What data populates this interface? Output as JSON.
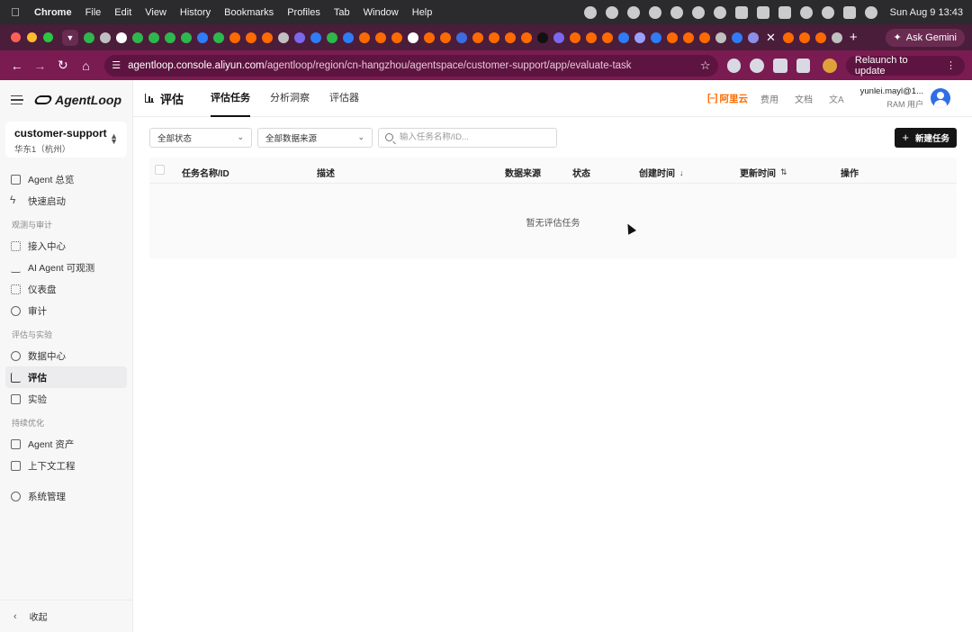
{
  "menubar": {
    "app": "Chrome",
    "items": [
      "File",
      "Edit",
      "View",
      "History",
      "Bookmarks",
      "Profiles",
      "Tab",
      "Window",
      "Help"
    ],
    "clock": "Sun Aug 9  13:43"
  },
  "tabstrip": {
    "gemini_label": "Ask Gemini",
    "tab_icon_colors": [
      "#2db84d",
      "#c0c0c0",
      "#ffffff",
      "#2db84d",
      "#2db84d",
      "#2db84d",
      "#2db84d",
      "#2e7cf6",
      "#2db84d",
      "#ff6a00",
      "#ff6a00",
      "#ff6a00",
      "#c0c0c0",
      "#7b68ee",
      "#2e7cf6",
      "#2db84d",
      "#2e7cf6",
      "#ff6a00",
      "#ff6a00",
      "#ff6a00",
      "#ffffff",
      "#ff6a00",
      "#ff6a00",
      "#3b6de0",
      "#ff6a00",
      "#ff6a00",
      "#ff6a00",
      "#ff6a00",
      "#111111",
      "#7b68ee",
      "#ff6a00",
      "#ff6a00",
      "#ff6a00",
      "#2e7cf6",
      "#9aa0ff",
      "#2e7cf6",
      "#ff6a00",
      "#ff6a00",
      "#ff6a00",
      "#c0c0c0",
      "#2e7cf6",
      "#8e8ee8"
    ],
    "tab_icon_colors_after": [
      "#ff6a00",
      "#ff6a00",
      "#ff6a00",
      "#c0c0c0"
    ]
  },
  "addressbar": {
    "url_host": "agentloop.console.aliyun.com",
    "url_path": "/agentloop/region/cn-hangzhou/agentspace/customer-support/app/evaluate-task",
    "relaunch": "Relaunch to update"
  },
  "sidebar": {
    "logo": "AgentLoop",
    "space_name": "customer-support",
    "space_region": "华东1（杭州）",
    "top_items": [
      {
        "label": "Agent 总览",
        "icon": "robot-icon"
      },
      {
        "label": "快速启动",
        "icon": "bolt-icon"
      }
    ],
    "groups": [
      {
        "title": "观测与审计",
        "items": [
          {
            "label": "接入中心",
            "icon": "grid-icon"
          },
          {
            "label": "AI Agent 可观测",
            "icon": "pulse-icon"
          },
          {
            "label": "仪表盘",
            "icon": "dashboard-icon"
          },
          {
            "label": "审计",
            "icon": "shield-icon"
          }
        ]
      },
      {
        "title": "评估与实验",
        "items": [
          {
            "label": "数据中心",
            "icon": "database-icon"
          },
          {
            "label": "评估",
            "icon": "bar-chart-icon",
            "active": true
          },
          {
            "label": "实验",
            "icon": "flask-icon"
          }
        ]
      },
      {
        "title": "持续优化",
        "items": [
          {
            "label": "Agent 资产",
            "icon": "folder-icon"
          },
          {
            "label": "上下文工程",
            "icon": "context-icon"
          }
        ]
      }
    ],
    "bottom_item": {
      "label": "系统管理",
      "icon": "settings-icon"
    },
    "collapse": "收起"
  },
  "header": {
    "title": "评估",
    "tabs": [
      "评估任务",
      "分析洞察",
      "评估器"
    ],
    "active_tab": 0,
    "brand": "阿里云",
    "links": [
      "费用",
      "文档"
    ],
    "user_name": "yunlei.mayl@1...",
    "user_role": "RAM 用户"
  },
  "toolbar": {
    "status_select": "全部状态",
    "source_select": "全部数据来源",
    "search_placeholder": "输入任务名称/ID...",
    "new_button": "新建任务"
  },
  "table": {
    "columns": [
      "任务名称/ID",
      "描述",
      "数据来源",
      "状态",
      "创建时间",
      "更新时间",
      "操作"
    ],
    "empty_text": "暂无评估任务"
  }
}
